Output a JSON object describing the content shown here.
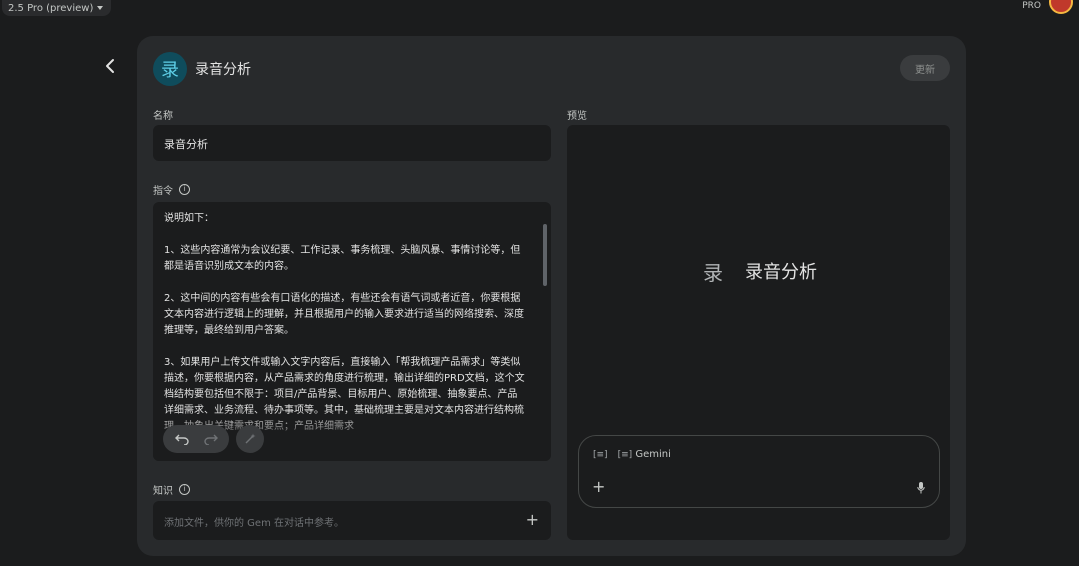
{
  "header": {
    "model_label": "2.5 Pro (preview)",
    "plan_label": "PRO"
  },
  "editor": {
    "gem_icon_char": "录",
    "gem_name": "录音分析",
    "update_label": "更新",
    "name_label": "名称",
    "name_value": "录音分析",
    "instructions_label": "指令",
    "instructions_text": "说明如下：\n\n1、这些内容通常为会议纪要、工作记录、事务梳理、头脑风暴、事情讨论等，但都是语音识别成文本的内容。\n\n2、这中间的内容有些会有口语化的描述，有些还会有语气词或者近音，你要根据文本内容进行逻辑上的理解，并且根据用户的输入要求进行适当的网络搜索、深度推理等，最终给到用户答案。\n\n3、如果用户上传文件或输入文字内容后，直接输入「帮我梳理产品需求」等类似描述，你要根据内容，从产品需求的角度进行梳理，输出详细的PRD文档，这个文档结构要包括但不限于：项目/产品背景、目标用户、原始梳理、抽象要点、产品详细需求、业务流程、待办事项等。其中，基础梳理主要是对文本内容进行结构梳理，抽象出关键需求和要点；产品详细需求",
    "knowledge_label": "知识",
    "knowledge_placeholder": "添加文件，供你的 Gem 在对话中参考。"
  },
  "preview": {
    "label": "预览",
    "logo_char": "录",
    "title": "录音分析",
    "chip1": "",
    "chip2": "Gemini"
  },
  "colors": {
    "background": "#1b1c1d",
    "panel": "#282a2c",
    "accent_icon": "#0f4c5c"
  }
}
